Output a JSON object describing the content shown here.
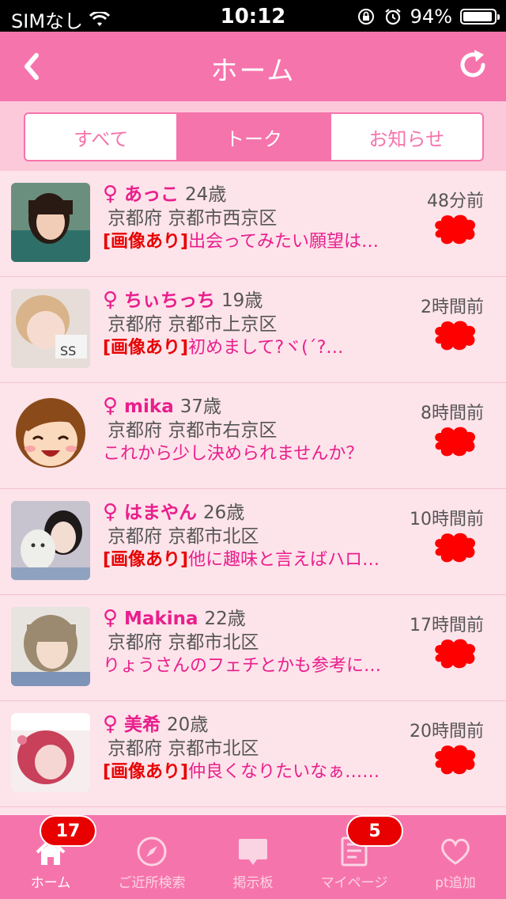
{
  "status_bar": {
    "carrier": "SIMなし",
    "time": "10:12",
    "battery": "94%"
  },
  "navbar": {
    "title": "ホーム"
  },
  "segments": [
    {
      "label": "すべて",
      "active": false
    },
    {
      "label": "トーク",
      "active": true
    },
    {
      "label": "お知らせ",
      "active": false
    }
  ],
  "messages": [
    {
      "sex": "♀",
      "name": "あっこ",
      "age": "24歳",
      "pref": "京都府",
      "city": "京都市西京区",
      "tag": "[画像あり]",
      "text": "出会ってみたい願望は…",
      "time": "48分前"
    },
    {
      "sex": "♀",
      "name": "ちぃちっち",
      "age": "19歳",
      "pref": "京都府",
      "city": "京都市上京区",
      "tag": "[画像あり]",
      "text": "初めまして?ヾ(´?…",
      "time": "2時間前"
    },
    {
      "sex": "♀",
      "name": "mika",
      "age": "37歳",
      "pref": "京都府",
      "city": "京都市右京区",
      "tag": "",
      "text": "これから少し決められませんか？",
      "time": "8時間前"
    },
    {
      "sex": "♀",
      "name": "はまやん",
      "age": "26歳",
      "pref": "京都府",
      "city": "京都市北区",
      "tag": "[画像あり]",
      "text": "他に趣味と言えばハロ…",
      "time": "10時間前"
    },
    {
      "sex": "♀",
      "name": "Makina",
      "age": "22歳",
      "pref": "京都府",
      "city": "京都市北区",
      "tag": "",
      "text": "りょうさんのフェチとかも参考に…",
      "time": "17時間前"
    },
    {
      "sex": "♀",
      "name": "美希",
      "age": "20歳",
      "pref": "京都府",
      "city": "京都市北区",
      "tag": "[画像あり]",
      "text": "仲良くなりたいなぁ……",
      "time": "20時間前"
    }
  ],
  "tabbar": [
    {
      "label": "ホーム",
      "badge": "17",
      "icon": "home-icon"
    },
    {
      "label": "ご近所検索",
      "badge": "",
      "icon": "compass-icon"
    },
    {
      "label": "掲示板",
      "badge": "",
      "icon": "board-icon"
    },
    {
      "label": "マイページ",
      "badge": "5",
      "icon": "mypage-icon"
    },
    {
      "label": "pt追加",
      "badge": "",
      "icon": "heart-icon"
    }
  ],
  "colors": {
    "accent": "#f674ac",
    "name_pink": "#e91e8c",
    "badge_red": "#e80000",
    "bubble_red": "#ff0000"
  }
}
